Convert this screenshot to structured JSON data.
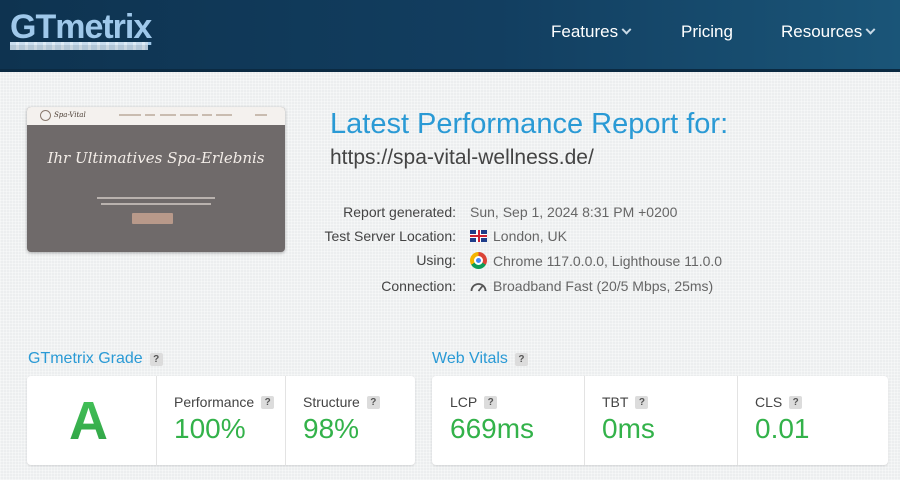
{
  "header": {
    "logo": "GTmetrix",
    "nav": [
      {
        "label": "Features",
        "has_dropdown": true
      },
      {
        "label": "Pricing",
        "has_dropdown": false
      },
      {
        "label": "Resources",
        "has_dropdown": true
      }
    ]
  },
  "preview": {
    "site_logo_text": "Spa-Vital",
    "hero_title": "Ihr Ultimatives Spa-Erlebnis"
  },
  "report": {
    "title": "Latest Performance Report for:",
    "url": "https://spa-vital-wellness.de/",
    "meta": [
      {
        "label": "Report generated:",
        "value": "Sun, Sep 1, 2024 8:31 PM +0200",
        "icon": ""
      },
      {
        "label": "Test Server Location:",
        "value": "London, UK",
        "icon": "uk-flag-icon"
      },
      {
        "label": "Using:",
        "value": "Chrome 117.0.0.0, Lighthouse 11.0.0",
        "icon": "chrome-icon"
      },
      {
        "label": "Connection:",
        "value": "Broadband Fast (20/5 Mbps, 25ms)",
        "icon": "gauge-icon"
      }
    ]
  },
  "grade": {
    "heading": "GTmetrix Grade",
    "help": "?",
    "letter": "A",
    "metrics": [
      {
        "label": "Performance",
        "value": "100%"
      },
      {
        "label": "Structure",
        "value": "98%"
      }
    ]
  },
  "vitals": {
    "heading": "Web Vitals",
    "help": "?",
    "metrics": [
      {
        "label": "LCP",
        "value": "669ms"
      },
      {
        "label": "TBT",
        "value": "0ms"
      },
      {
        "label": "CLS",
        "value": "0.01"
      }
    ]
  },
  "colors": {
    "header_bg": "#123e60",
    "accent_blue": "#2a9ad5",
    "grade_green": "#33b24a"
  }
}
